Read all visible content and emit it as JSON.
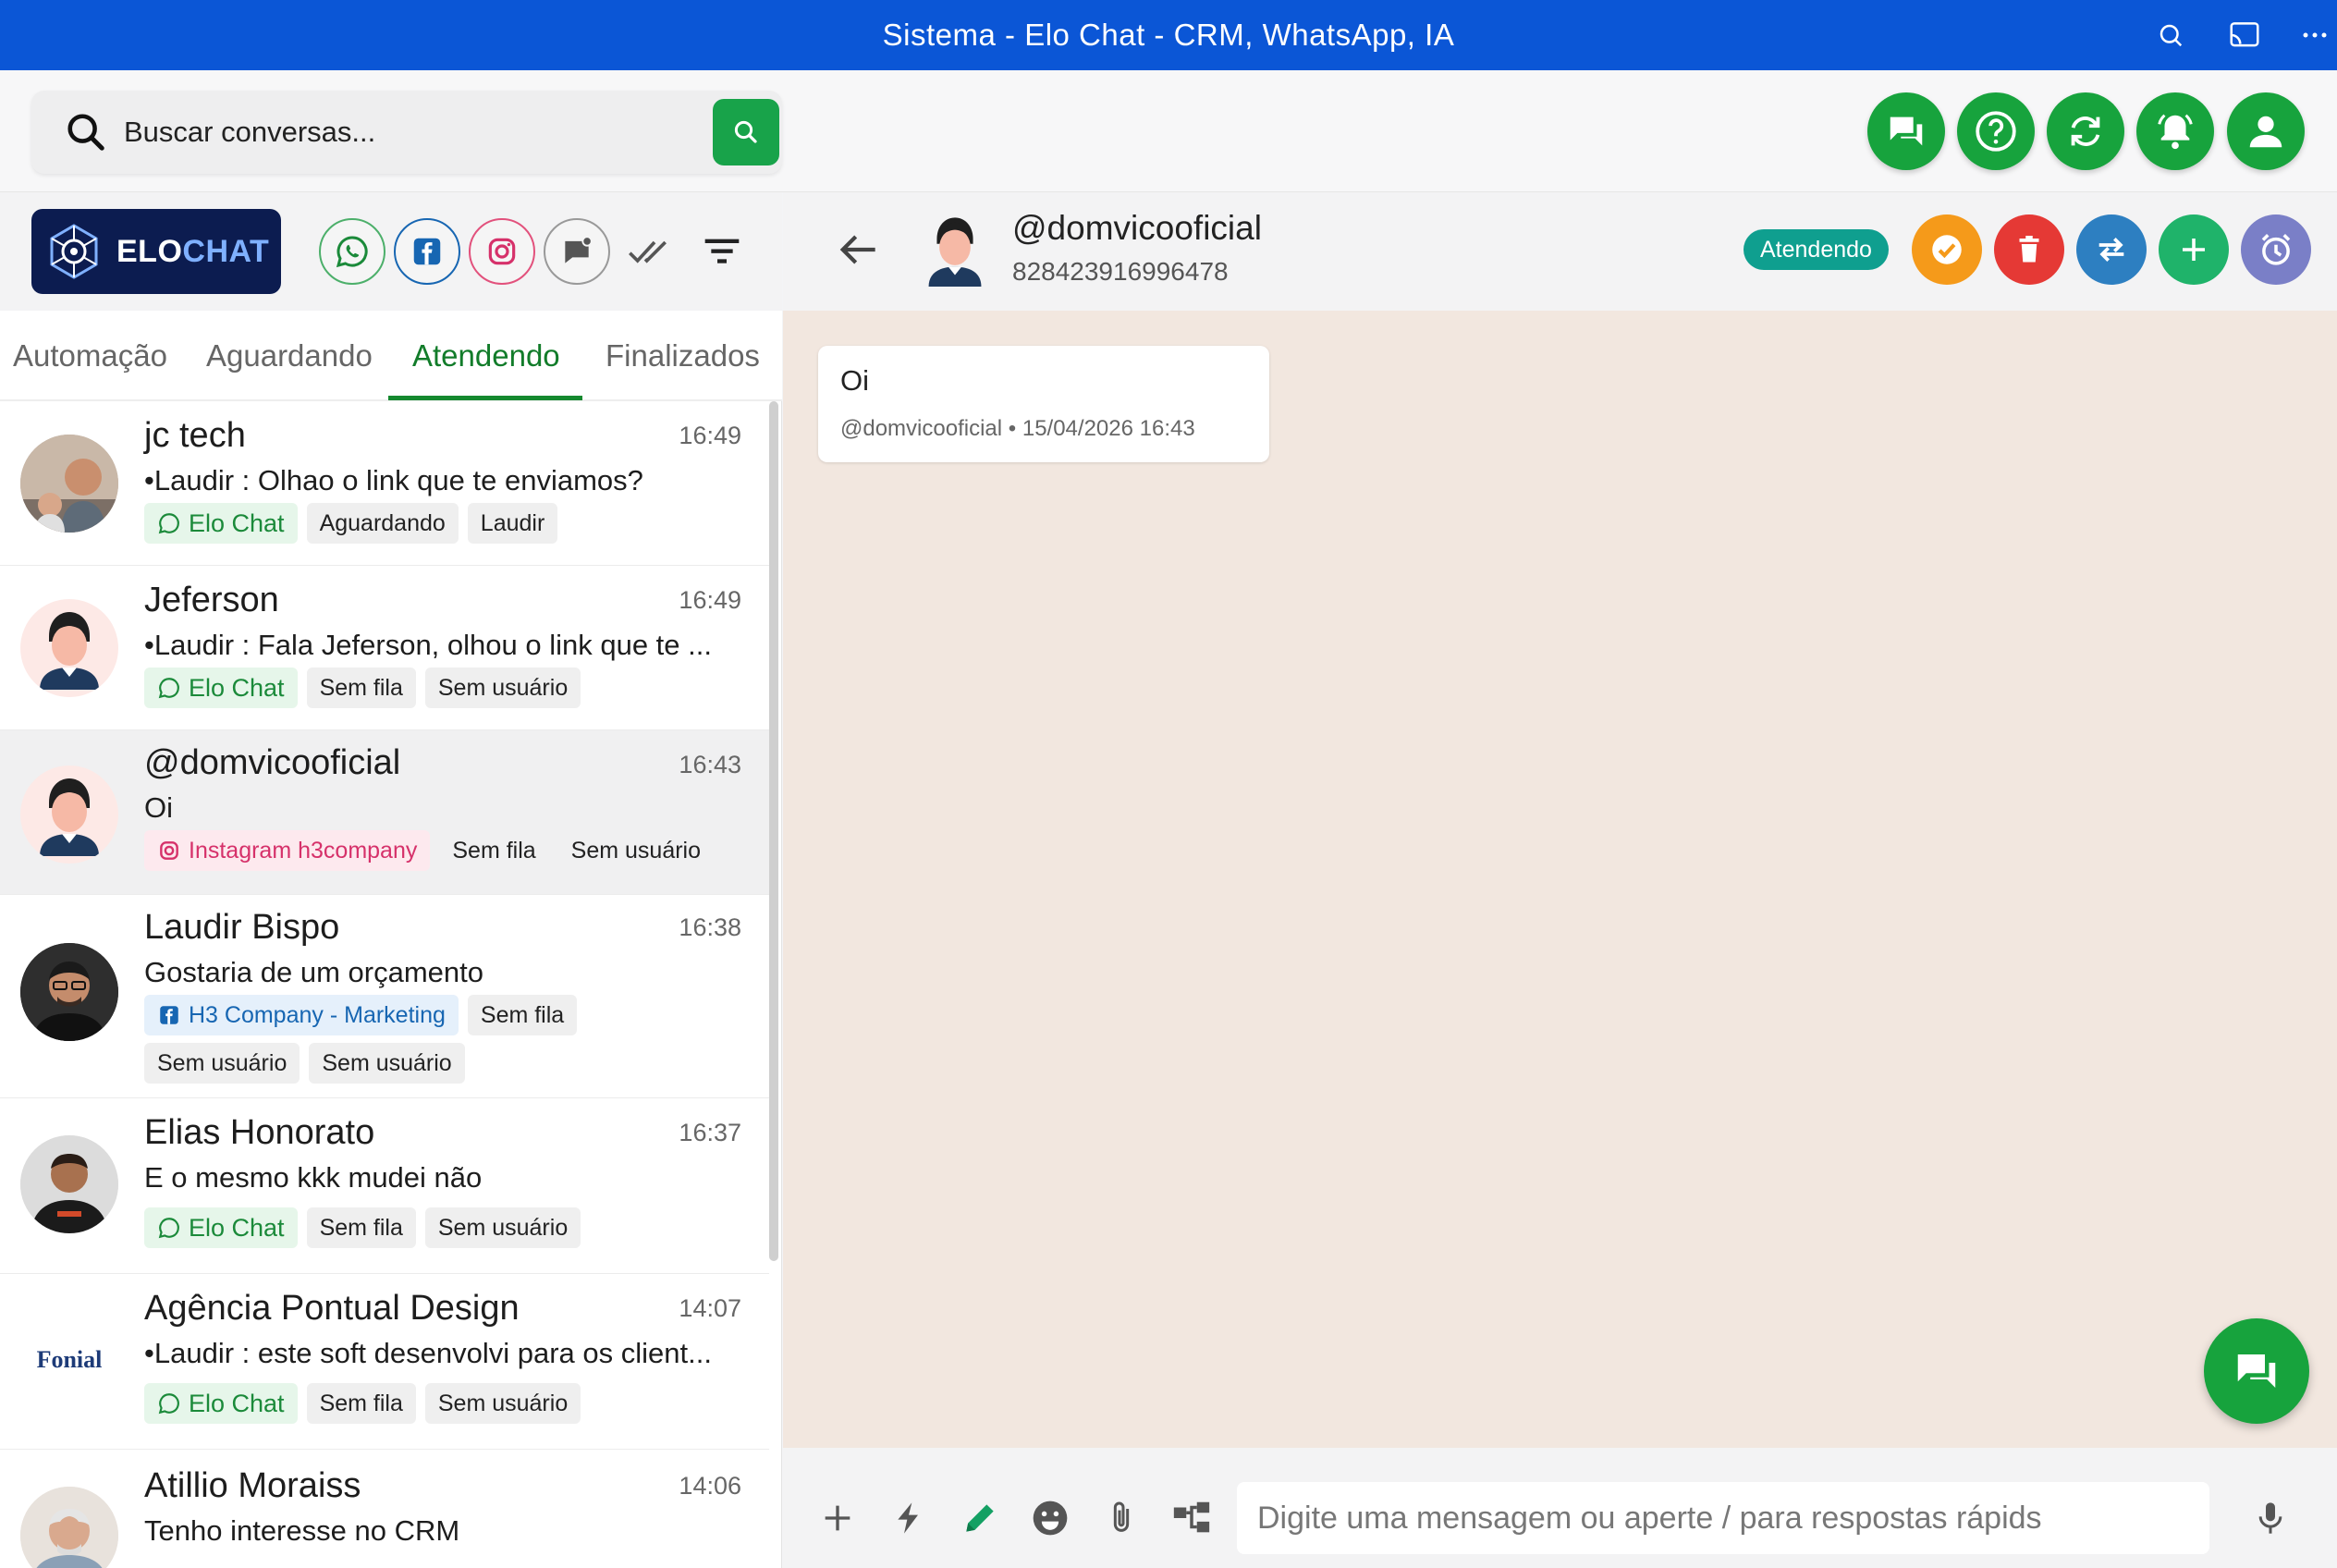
{
  "window": {
    "title": "Sistema - Elo Chat - CRM, WhatsApp, IA"
  },
  "search": {
    "placeholder": "Buscar conversas..."
  },
  "logo": {
    "part1": "ELO",
    "part2": "CHAT"
  },
  "tabs": [
    "Automação",
    "Aguardando",
    "Atendendo",
    "Finalizados"
  ],
  "active_tab": "Atendendo",
  "conversations": [
    {
      "name": "jc tech",
      "time": "16:49",
      "message": "•Laudir : Olhao o link que te enviamos?",
      "channel": "Elo Chat",
      "tags": [
        "Aguardando",
        "Laudir"
      ]
    },
    {
      "name": "Jeferson",
      "time": "16:49",
      "message": "•Laudir : Fala Jeferson, olhou o link que te ...",
      "channel": "Elo Chat",
      "tags": [
        "Sem fila",
        "Sem usuário"
      ]
    },
    {
      "name": "@domvicooficial",
      "time": "16:43",
      "message": "Oi",
      "channel": "Instagram h3company",
      "tags": [
        "Sem fila",
        "Sem usuário"
      ]
    },
    {
      "name": "Laudir Bispo",
      "time": "16:38",
      "message": "Gostaria de um orçamento",
      "channel": "H3 Company - Marketing",
      "tags": [
        "Sem fila",
        "Sem usuário",
        "Sem usuário"
      ]
    },
    {
      "name": "Elias Honorato",
      "time": "16:37",
      "message": "E o mesmo kkk mudei não",
      "channel": "Elo Chat",
      "tags": [
        "Sem fila",
        "Sem usuário"
      ]
    },
    {
      "name": "Agência Pontual Design",
      "time": "14:07",
      "message": "•Laudir : este soft desenvolvi para os client...",
      "channel": "Elo Chat",
      "tags": [
        "Sem fila",
        "Sem usuário"
      ],
      "avatar_text": "Fonial"
    },
    {
      "name": "Atillio Moraiss",
      "time": "14:06",
      "message": "Tenho interesse no CRM"
    }
  ],
  "chat": {
    "contact_name": "@domvicooficial",
    "contact_number": "828423916996478",
    "status": "Atendendo",
    "messages": [
      {
        "text": "Oi",
        "author": "@domvicooficial",
        "timestamp": "15/04/2026 16:43"
      }
    ]
  },
  "composer": {
    "placeholder": "Digite uma mensagem ou aperte / para respostas rápids"
  },
  "colors": {
    "titlebar": "#0b56d6",
    "brand_green": "#17a33d",
    "logo_bg": "#0c1c50",
    "status_teal": "#0f9f8f",
    "resolve_orange": "#f59a1a",
    "delete_red": "#e53935",
    "transfer_blue": "#2d7fc1",
    "add_green": "#1fb36a",
    "schedule_purple": "#7a7fc7",
    "chat_background": "#f2e7df"
  },
  "icons": {
    "titlebar": [
      "zoom-icon",
      "cast-icon",
      "more-icon"
    ],
    "top_actions": [
      "chats-icon",
      "help-icon",
      "refresh-icon",
      "notifications-icon",
      "user-icon"
    ],
    "channels": [
      "whatsapp-icon",
      "facebook-icon",
      "instagram-icon",
      "webchat-icon",
      "double-check-icon",
      "filter-icon"
    ],
    "chat_actions": [
      "resolve-icon",
      "delete-icon",
      "transfer-icon",
      "add-icon",
      "schedule-icon"
    ],
    "composer": [
      "plus-icon",
      "lightning-icon",
      "pencil-icon",
      "emoji-icon",
      "attach-icon",
      "flow-icon",
      "mic-icon"
    ]
  }
}
